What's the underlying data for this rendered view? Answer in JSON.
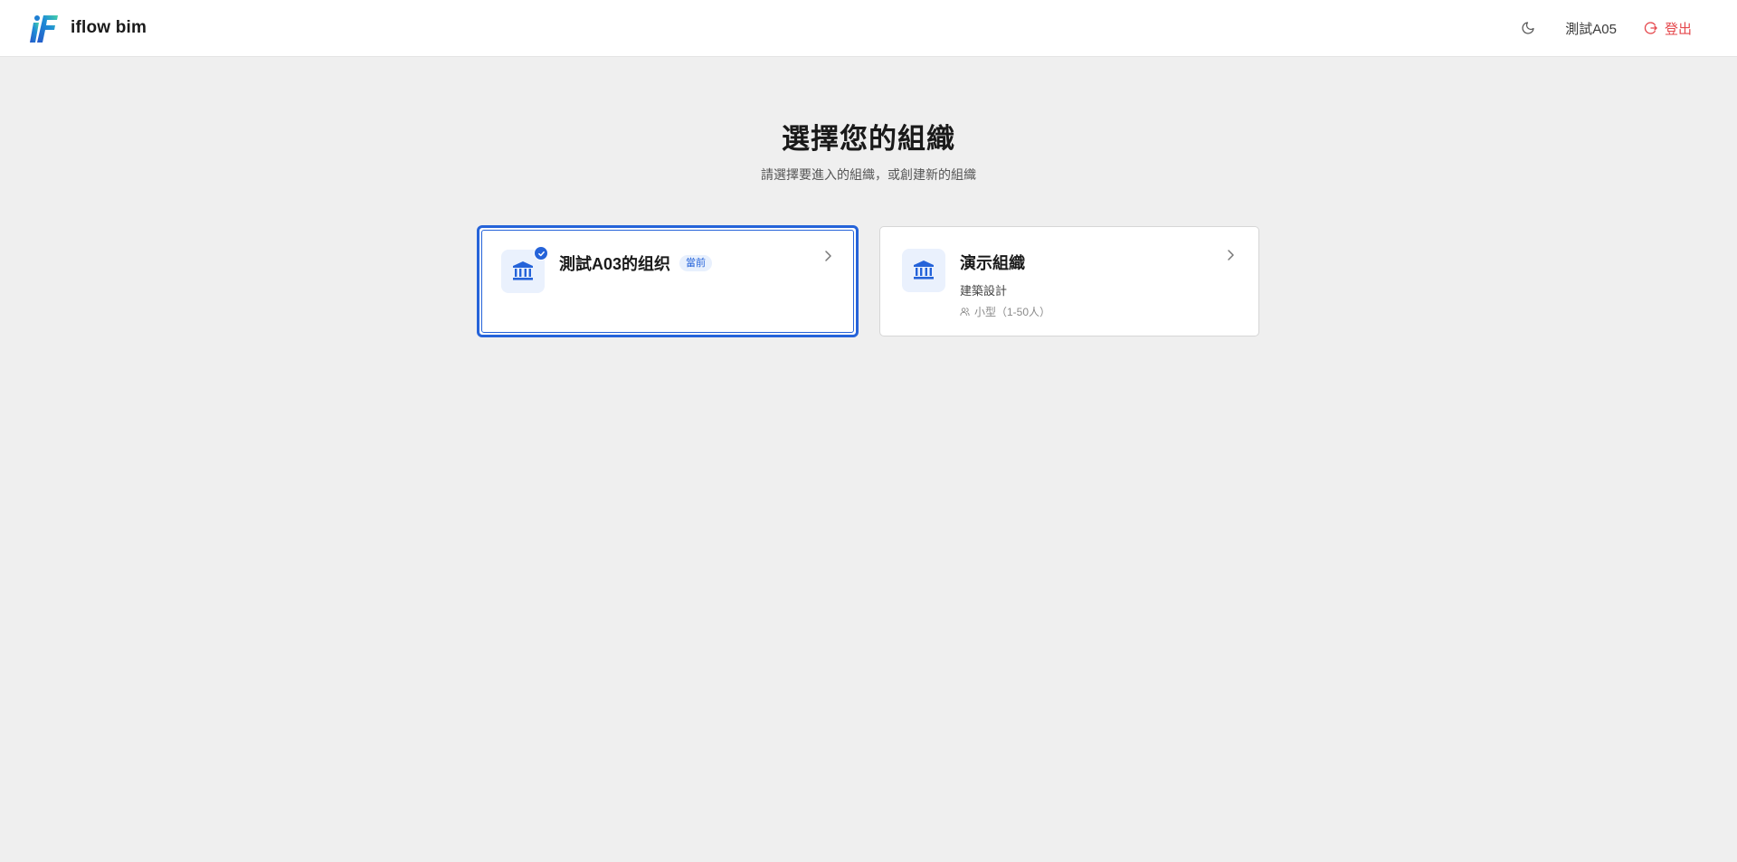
{
  "header": {
    "brand_name": "iflow bim",
    "logo_icon": "iflow-logo",
    "theme_icon": "moon-icon",
    "user_name": "測試A05",
    "logout_label": "登出",
    "logout_icon": "logout-icon"
  },
  "main": {
    "title": "選擇您的組織",
    "subtitle": "請選擇要進入的組織，或創建新的組織"
  },
  "organizations": [
    {
      "name": "測試A03的组织",
      "badge": "當前",
      "is_current": true,
      "icon": "building-icon"
    },
    {
      "name": "演示組織",
      "type": "建築設計",
      "size": "小型（1-50人）",
      "is_current": false,
      "icon": "building-icon"
    }
  ],
  "colors": {
    "accent": "#2563d9",
    "logout": "#e5484d",
    "background": "#efefef"
  }
}
